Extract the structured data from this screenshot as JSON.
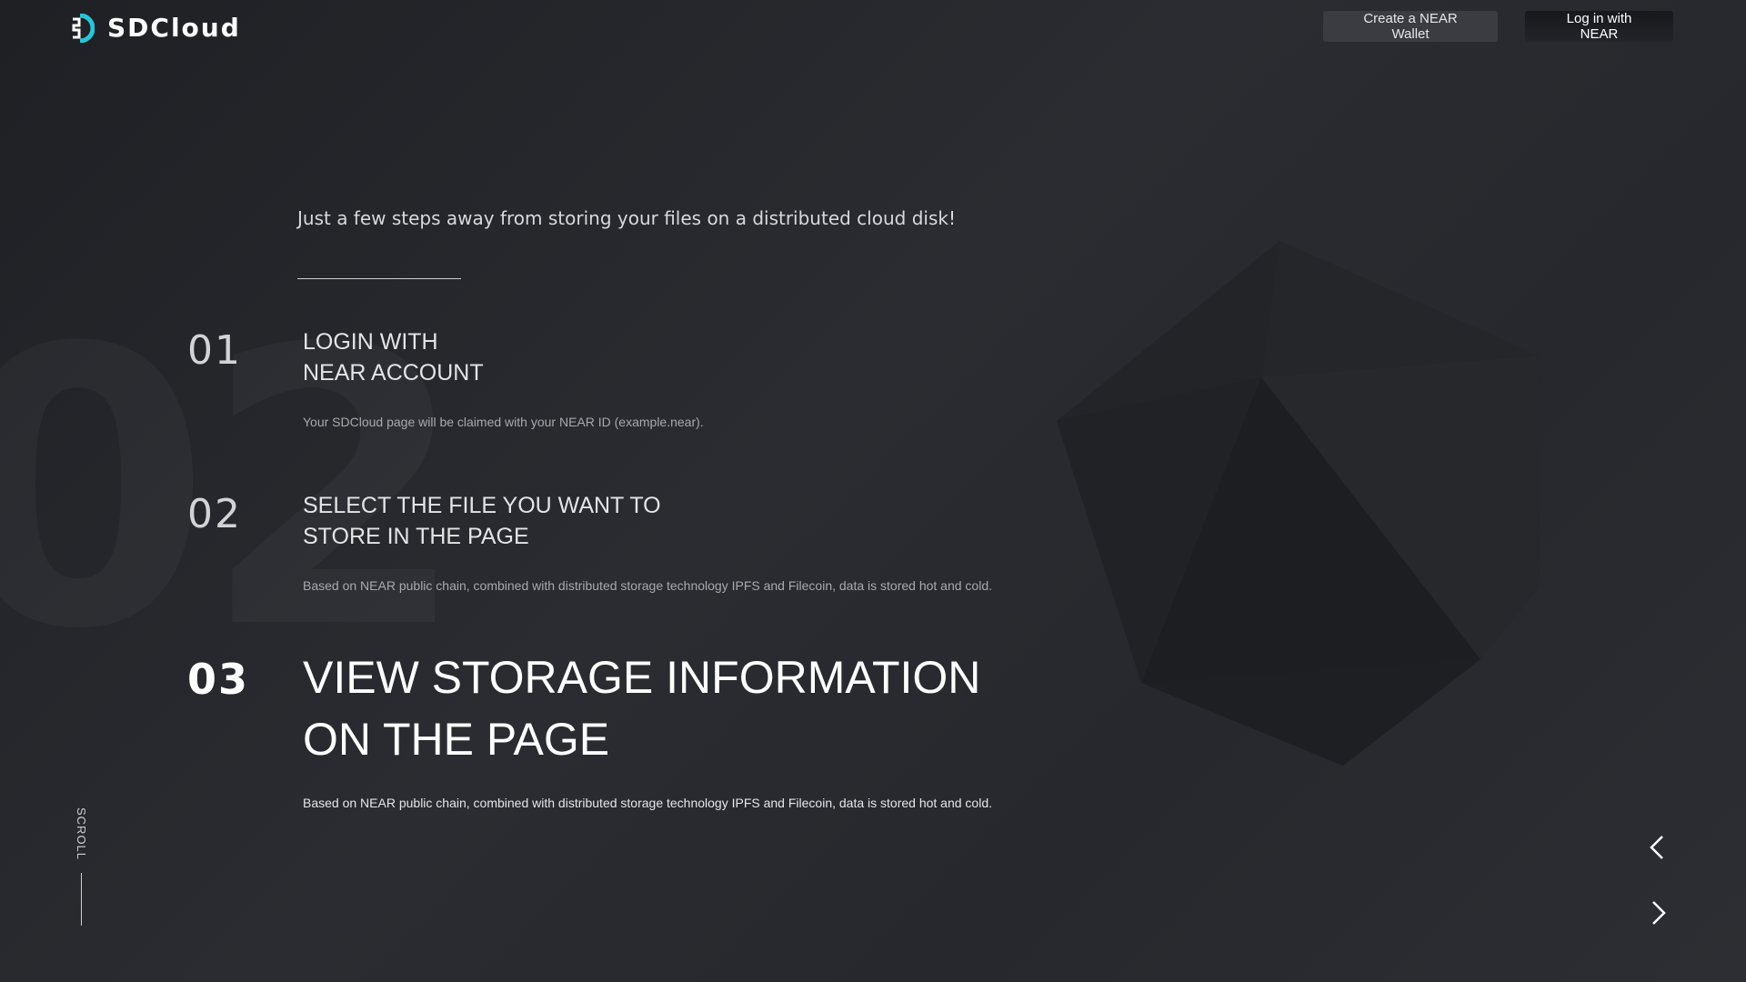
{
  "header": {
    "brand": "SDCloud",
    "create_wallet_label": "Create a NEAR Wallet",
    "login_label": "Log in with NEAR"
  },
  "background": {
    "numeral": "02"
  },
  "intro": {
    "text": "Just a few steps away from storing your files on a distributed cloud disk!"
  },
  "steps": [
    {
      "number": "01",
      "title_line1": "LOGIN WITH",
      "title_line2": "NEAR ACCOUNT",
      "description": "Your SDCloud page will be claimed with your NEAR ID (example.near)."
    },
    {
      "number": "02",
      "title_line1": "SELECT THE FILE YOU WANT TO",
      "title_line2": "STORE IN THE PAGE",
      "description": "Based on NEAR public chain, combined with distributed storage technology IPFS and Filecoin, data is stored hot and cold."
    },
    {
      "number": "03",
      "title_line1": "VIEW STORAGE INFORMATION",
      "title_line2": "ON THE PAGE",
      "description": "Based on NEAR public chain, combined with distributed storage technology IPFS and Filecoin, data is stored hot and cold."
    }
  ],
  "scroll": {
    "label": "SCROLL"
  },
  "navigation": {
    "prev_icon": "chevron-left-icon",
    "next_icon": "chevron-right-icon"
  },
  "colors": {
    "background": "#26282d",
    "logo_accent": "#29c4d8",
    "button_create": "#3a3c42",
    "button_login": "#17181b"
  }
}
